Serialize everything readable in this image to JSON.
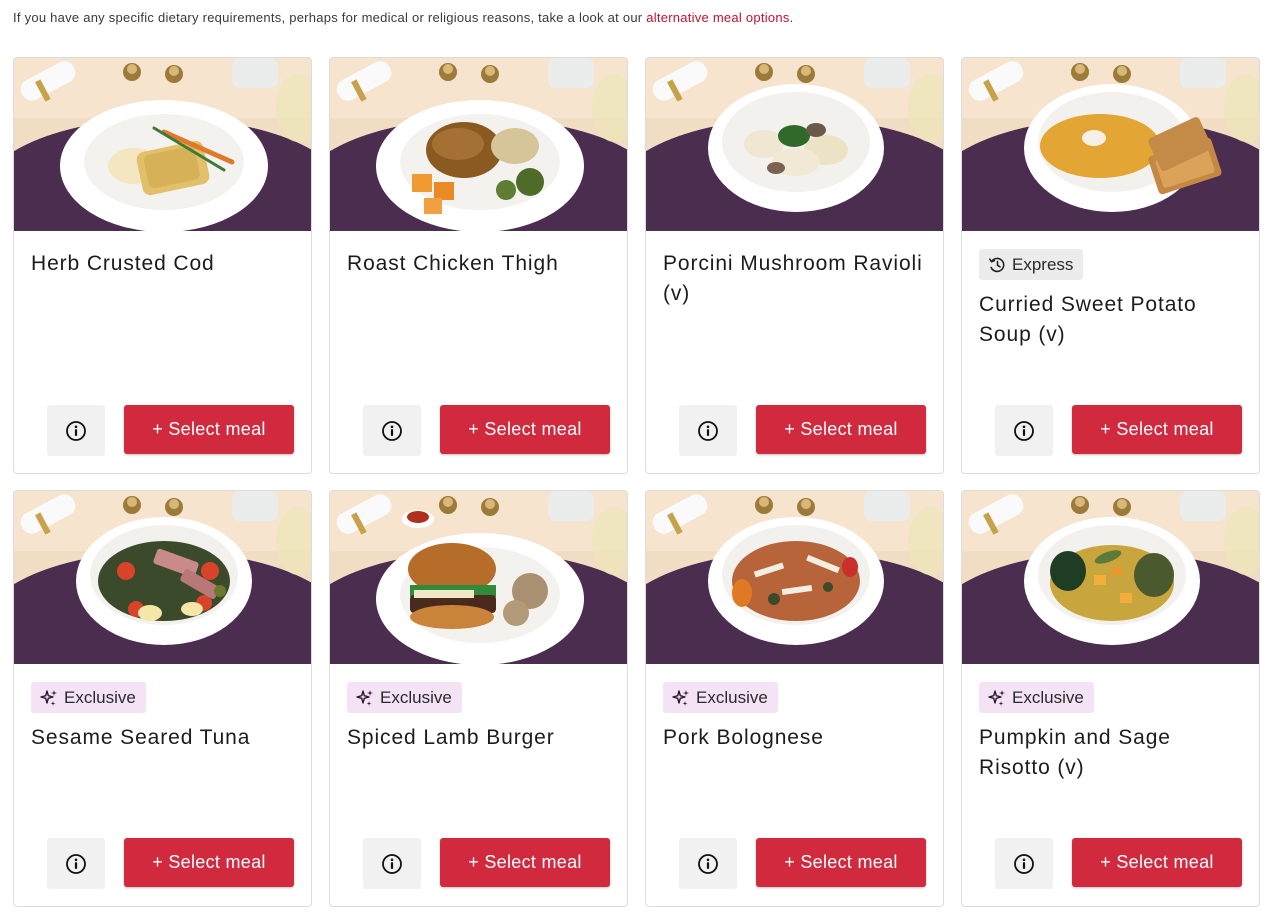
{
  "intro": {
    "text": "If you have any specific dietary requirements, perhaps for medical or religious reasons, take a look at our ",
    "link": "alternative meal options",
    "end": "."
  },
  "colors": {
    "accent": "#c8102e",
    "select_button": "#d12a3f",
    "exclusive_badge": "#f3e3f5",
    "express_badge": "#ececec",
    "placemat": "#4a2d4f",
    "table": "#f1dcc4"
  },
  "button_labels": {
    "select": "+ Select meal",
    "info_icon": "info-circle-icon"
  },
  "meals": [
    {
      "title": "Herb Crusted Cod",
      "badge": null,
      "badge_icon": null,
      "dish": "plate-fish"
    },
    {
      "title": "Roast Chicken Thigh",
      "badge": null,
      "badge_icon": null,
      "dish": "plate-chicken"
    },
    {
      "title": "Porcini Mushroom Ravioli (v)",
      "badge": null,
      "badge_icon": null,
      "dish": "bowl-ravioli"
    },
    {
      "title": "Curried Sweet Potato Soup (v)",
      "badge": "Express",
      "badge_icon": "clock-icon",
      "dish": "bowl-soup"
    },
    {
      "title": "Sesame Seared Tuna",
      "badge": "Exclusive",
      "badge_icon": "sparkles-icon",
      "dish": "bowl-salad"
    },
    {
      "title": "Spiced Lamb Burger",
      "badge": "Exclusive",
      "badge_icon": "sparkles-icon",
      "dish": "plate-burger"
    },
    {
      "title": "Pork Bolognese",
      "badge": "Exclusive",
      "badge_icon": "sparkles-icon",
      "dish": "bowl-pasta"
    },
    {
      "title": "Pumpkin and Sage Risotto (v)",
      "badge": "Exclusive",
      "badge_icon": "sparkles-icon",
      "dish": "bowl-risotto"
    }
  ]
}
